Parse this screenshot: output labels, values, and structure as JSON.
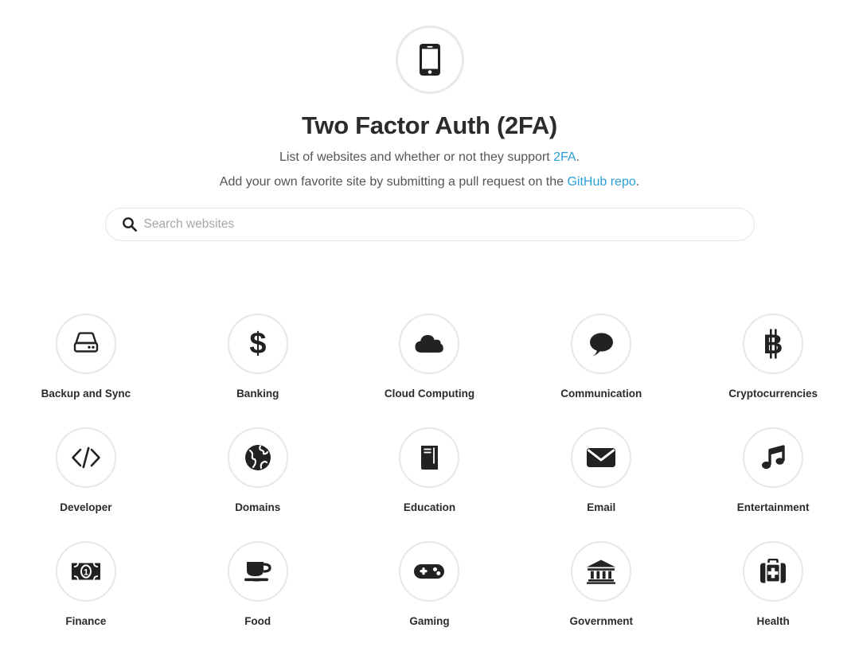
{
  "header": {
    "logo_icon": "mobile-phone-icon",
    "title": "Two Factor Auth (2FA)",
    "tagline_1_before": "List of websites and whether or not they support ",
    "tagline_1_link": "2FA",
    "tagline_1_after": ".",
    "tagline_2_before": "Add your own favorite site by submitting a pull request on the ",
    "tagline_2_link": "GitHub repo",
    "tagline_2_after": "."
  },
  "search": {
    "icon": "search-icon",
    "placeholder": "Search websites",
    "value": ""
  },
  "colors": {
    "link": "#2b9fd9",
    "text": "#2b2b2b",
    "muted": "#555555",
    "placeholder": "#a6a6a6",
    "circle_border": "#e7e7e7",
    "background": "#ffffff"
  },
  "categories": [
    {
      "label": "Backup and Sync",
      "icon": "hard-drive-icon"
    },
    {
      "label": "Banking",
      "icon": "dollar-sign-icon"
    },
    {
      "label": "Cloud Computing",
      "icon": "cloud-icon"
    },
    {
      "label": "Communication",
      "icon": "speech-bubble-icon"
    },
    {
      "label": "Cryptocurrencies",
      "icon": "bitcoin-icon"
    },
    {
      "label": "Developer",
      "icon": "code-brackets-icon"
    },
    {
      "label": "Domains",
      "icon": "globe-icon"
    },
    {
      "label": "Education",
      "icon": "book-icon"
    },
    {
      "label": "Email",
      "icon": "envelope-icon"
    },
    {
      "label": "Entertainment",
      "icon": "music-note-icon"
    },
    {
      "label": "Finance",
      "icon": "banknote-icon"
    },
    {
      "label": "Food",
      "icon": "coffee-cup-icon"
    },
    {
      "label": "Gaming",
      "icon": "gamepad-icon"
    },
    {
      "label": "Government",
      "icon": "bank-building-icon"
    },
    {
      "label": "Health",
      "icon": "medical-kit-icon"
    }
  ]
}
